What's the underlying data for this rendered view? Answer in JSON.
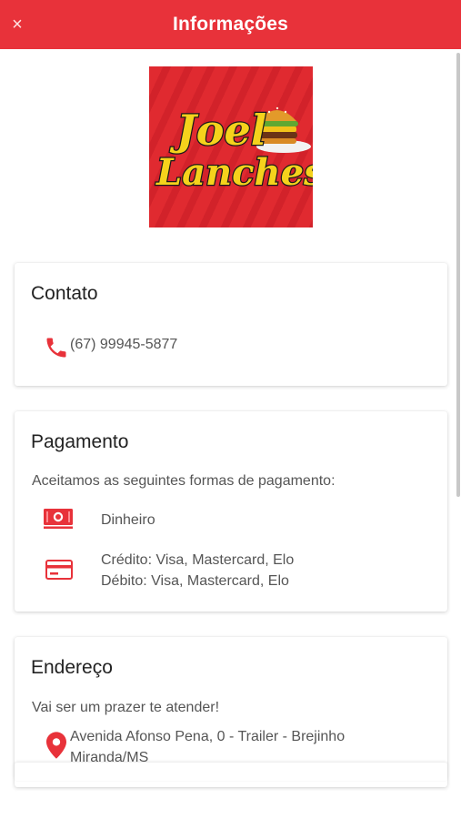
{
  "header": {
    "title": "Informações",
    "close_symbol": "×"
  },
  "logo": {
    "line1": "Joel",
    "line2": "Lanches"
  },
  "contact": {
    "title": "Contato",
    "phone": "(67) 99945-5877",
    "icon": "phone-icon"
  },
  "payment": {
    "title": "Pagamento",
    "intro": "Aceitamos as seguintes formas de pagamento:",
    "cash": {
      "label": "Dinheiro",
      "icon": "cash-icon"
    },
    "card": {
      "credit": "Crédito: Visa, Mastercard, Elo",
      "debit": "Débito: Visa, Mastercard, Elo",
      "icon": "credit-card-icon"
    }
  },
  "address": {
    "title": "Endereço",
    "greeting": "Vai ser um prazer te atender!",
    "line1": "Avenida Afonso Pena, 0 - Trailer - Brejinho",
    "line2": "Miranda/MS",
    "icon": "location-pin-icon"
  },
  "colors": {
    "accent": "#e8323a",
    "logo_yellow": "#f5d21c"
  }
}
